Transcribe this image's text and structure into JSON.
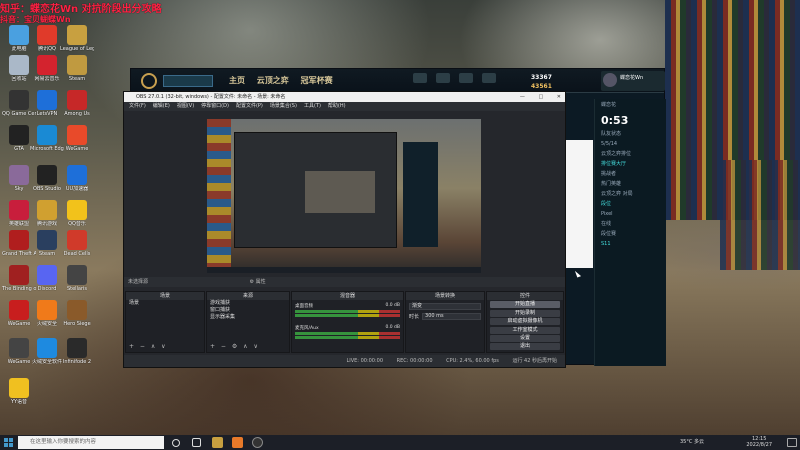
{
  "banner": {
    "line1": "知乎：蝶恋花Wn 对抗阶段出分攻略",
    "line2": "抖音：宝贝蝴蝶Wn"
  },
  "desktop_icons": [
    {
      "label": "此电脑",
      "color": "#4aa0e0"
    },
    {
      "label": "腾讯QQ",
      "color": "#e03a2a"
    },
    {
      "label": "League of Legends",
      "color": "#c8a040"
    },
    {
      "label": "回收站",
      "color": "#aab8c8"
    },
    {
      "label": "网易云音乐",
      "color": "#d3232e"
    },
    {
      "label": "Steam",
      "color": "#c09a40"
    },
    {
      "label": "QQ Game Center",
      "color": "#333"
    },
    {
      "label": "LetsVPN",
      "color": "#1e6fd9"
    },
    {
      "label": "Among Us",
      "color": "#c62828"
    },
    {
      "label": "GTA",
      "color": "#222"
    },
    {
      "label": "Microsoft Edge",
      "color": "#1a8ad4"
    },
    {
      "label": "WeGame",
      "color": "#e84a2a"
    },
    {
      "label": "Sky",
      "color": "#8a6a9a"
    },
    {
      "label": "OBS Studio",
      "color": "#222"
    },
    {
      "label": "UU加速器",
      "color": "#1e6fd9"
    },
    {
      "label": "英雄联盟",
      "color": "#c81e3c"
    },
    {
      "label": "腾讯游戏",
      "color": "#d0a030"
    },
    {
      "label": "QQ音乐",
      "color": "#f2c21b"
    },
    {
      "label": "Grand Theft Auto",
      "color": "#b01e1e"
    },
    {
      "label": "Steam",
      "color": "#2a3f5f"
    },
    {
      "label": "Dead Cells",
      "color": "#d03a2a"
    },
    {
      "label": "The Binding of Isaac",
      "color": "#a02020"
    },
    {
      "label": "Discord",
      "color": "#5865f2"
    },
    {
      "label": "Stellaris",
      "color": "#444"
    },
    {
      "label": "WeGame",
      "color": "#c81e1e"
    },
    {
      "label": "火绒安全",
      "color": "#f07a1a"
    },
    {
      "label": "Hero Siege",
      "color": "#8a5a2a"
    },
    {
      "label": "WeGame",
      "color": "#444"
    },
    {
      "label": "火绒安全软件",
      "color": "#1e8ae0"
    },
    {
      "label": "Infinifode 2",
      "color": "#2a2a2a"
    },
    {
      "label": "YY语音",
      "color": "#f0c020"
    }
  ],
  "game_client": {
    "nav": [
      "主页",
      "云顶之弈",
      "冠军杯赛"
    ],
    "top_icons": [
      "商店",
      "藏品",
      "战利品",
      "个人资料"
    ],
    "currency_blue": "33367",
    "currency_orange": "43561",
    "profile_name": "蝶恋花Wn",
    "side_title": "蝶恋花",
    "timer": "0:53",
    "side_lines": [
      "队友状态",
      "5/5/14",
      "云顶之弈排位",
      "排位赛大厅",
      "挑战者",
      "热门英雄",
      "云顶之弈 对局",
      "段位",
      "Pixel",
      "在线",
      "段位赛",
      "S11"
    ]
  },
  "obs": {
    "title": "OBS 27.0.1 (32-bit, windows) - 配置文件: 未命名 - 场景: 未命名",
    "window_buttons": [
      "—",
      "□",
      "✕"
    ],
    "menu": [
      "文件(F)",
      "编辑(E)",
      "视图(V)",
      "停靠窗口(D)",
      "配置文件(P)",
      "场景集合(S)",
      "工具(T)",
      "帮助(H)"
    ],
    "transition_bar": "未选择源",
    "transition_icons": "⚙ 属性",
    "docks": {
      "scenes": {
        "title": "场景",
        "items": [
          "场景"
        ]
      },
      "sources": {
        "title": "来源",
        "items": [
          "游戏捕获",
          "窗口捕获",
          "显示器采集"
        ]
      },
      "mixer": {
        "title": "混音器",
        "rows": [
          {
            "name": "桌面音频",
            "db": "0.0 dB"
          },
          {
            "name": "麦克风/Aux",
            "db": "0.0 dB"
          }
        ]
      },
      "transitions": {
        "title": "场景转换",
        "type": "渐变",
        "duration_label": "时长",
        "duration": "300 ms"
      },
      "controls": {
        "title": "控件",
        "buttons": [
          "开始直播",
          "开始录制",
          "启动虚拟摄像机",
          "工作室模式",
          "设置",
          "退出"
        ]
      }
    },
    "status": [
      "LIVE: 00:00:00",
      "REC: 00:00:00",
      "CPU: 2.4%, 60.00 fps",
      "运行 42 秒后再开始"
    ]
  },
  "taskbar": {
    "search_placeholder": "在这里输入你要搜索的内容",
    "weather": "35°C 多云",
    "time": "12:15",
    "date": "2022/8/27"
  }
}
